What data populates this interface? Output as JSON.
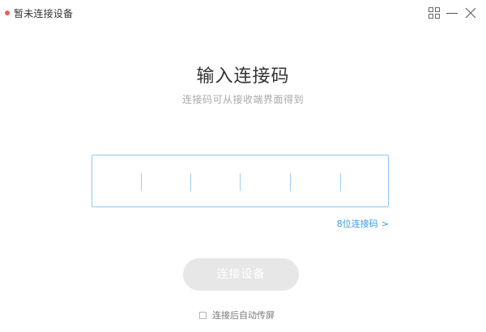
{
  "window": {
    "title": "暂未连接设备",
    "status_color": "#f05b5b",
    "controls": [
      "grid-icon",
      "minimize-icon",
      "close-icon"
    ]
  },
  "main": {
    "title": "输入连接码",
    "subtitle": "连接码可从接收端界面得到",
    "code_input": {
      "value": "",
      "slots_visible": 5
    },
    "code_length_link": "8位连接码",
    "code_length_link_icon": ">",
    "connect_button": "连接设备",
    "auto_cast": {
      "label": "连接后自动传屏",
      "checked": false
    }
  },
  "colors": {
    "accent": "#3b9be6",
    "input_border": "#8ec7f2",
    "button_disabled": "#e7e7e7"
  }
}
